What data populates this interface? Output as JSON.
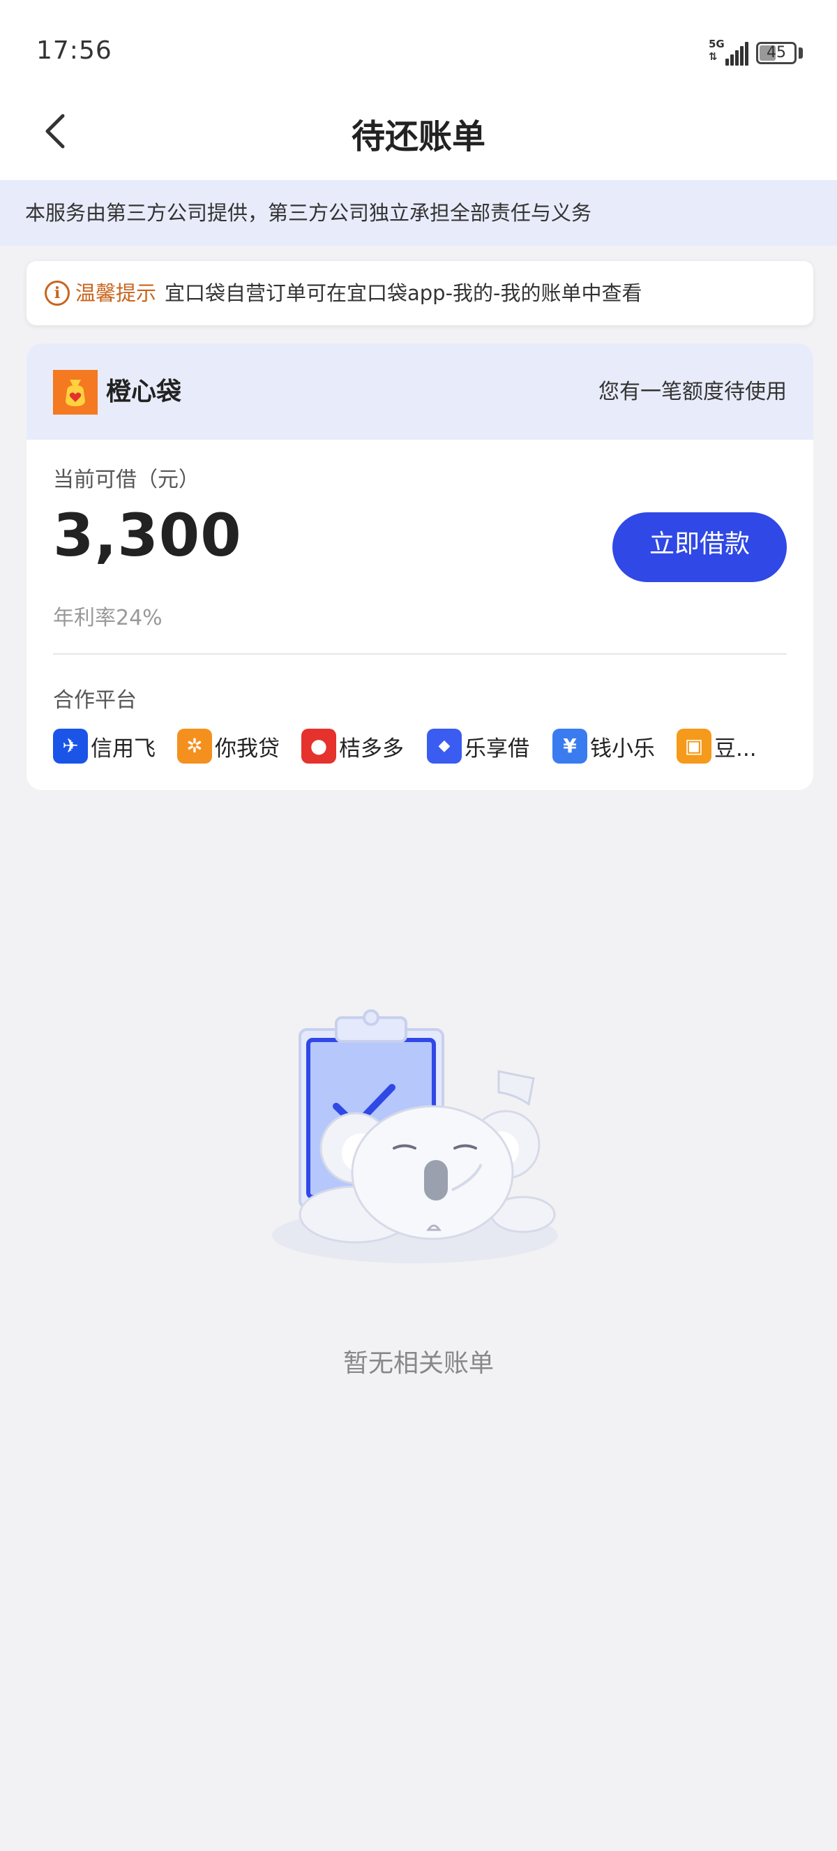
{
  "status_bar": {
    "time": "17:56",
    "network": "5G",
    "battery": "45",
    "signal_icon": "signal-bars-icon",
    "battery_icon": "battery-icon"
  },
  "nav": {
    "title": "待还账单",
    "back_icon": "chevron-left-icon"
  },
  "service_notice": "本服务由第三方公司提供，第三方公司独立承担全部责任与义务",
  "tip": {
    "label": "温馨提示",
    "text": "宜口袋自营订单可在宜口袋app-我的-我的账单中查看",
    "icon": "info-icon",
    "color": "#c8641e"
  },
  "loan_card": {
    "brand_name": "橙心袋",
    "brand_logo": "money-bag-heart-icon",
    "header_hint": "您有一笔额度待使用",
    "amount_label": "当前可借（元）",
    "amount": "3,300",
    "borrow_button": "立即借款",
    "rate": "年利率24%",
    "partner_label": "合作平台",
    "accent_color": "#3048e6",
    "partners": [
      {
        "name": "信用飞",
        "icon": "xinyongfei-logo-icon",
        "color": "#1a55e8"
      },
      {
        "name": "你我贷",
        "icon": "niwodai-logo-icon",
        "color": "#f4901e"
      },
      {
        "name": "桔多多",
        "icon": "juduoduo-logo-icon",
        "color": "#e5322d"
      },
      {
        "name": "乐享借",
        "icon": "lexiangjie-logo-icon",
        "color": "#3a5cf0"
      },
      {
        "name": "钱小乐",
        "icon": "qianxiaole-logo-icon",
        "color": "#3a7cf0"
      },
      {
        "name": "豆...",
        "icon": "dou-logo-icon",
        "color": "#f59a1a"
      }
    ]
  },
  "empty_state": {
    "illustration": "sleeping-koala-clipboard-illustration",
    "text": "暂无相关账单"
  }
}
